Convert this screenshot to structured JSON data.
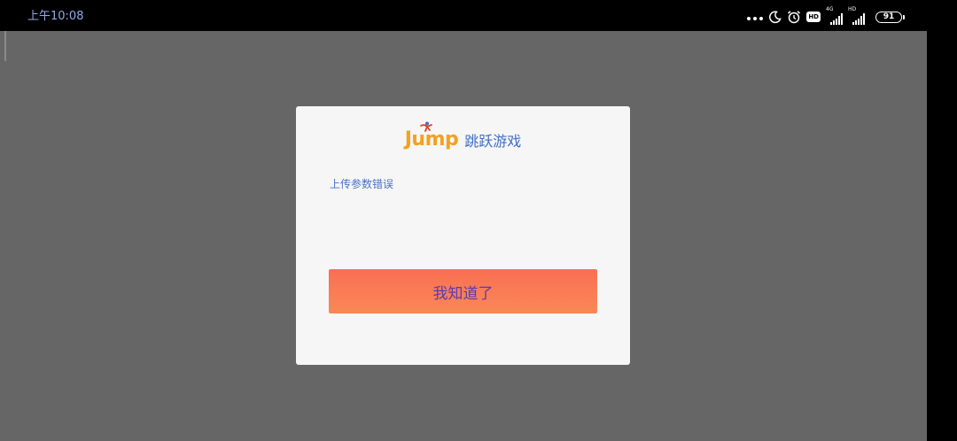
{
  "status_bar": {
    "time": "上午10:08",
    "icons": [
      "more-dots-icon",
      "moon-icon",
      "alarm-icon",
      "hd-icon",
      "signal-4g-icon",
      "signal-hd-icon",
      "battery-icon"
    ],
    "hd_label": "HD",
    "net1_label": "4G",
    "net2_label": "HD",
    "battery_level": "91"
  },
  "dialog": {
    "logo_text": "Jump",
    "logo_cn": "跳跃游戏",
    "message": "上传参数错误",
    "button_label": "我知道了",
    "colors": {
      "logo_orange": "#f4a11f",
      "logo_blue": "#3f6fc4",
      "button_top": "#f96f54",
      "button_bottom": "#fa8856"
    }
  },
  "overlay_color": "#666666"
}
